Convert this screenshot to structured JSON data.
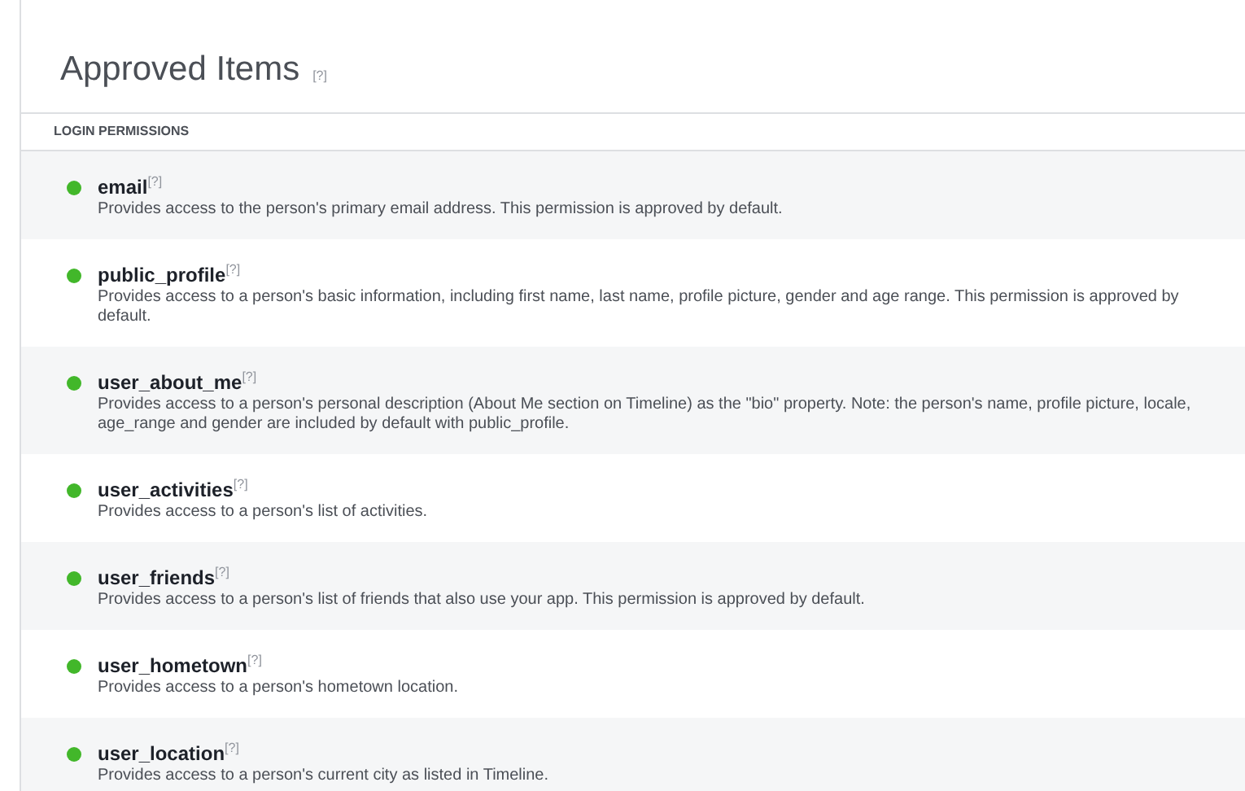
{
  "title": "Approved Items",
  "title_help": "[?]",
  "section": "LOGIN PERMISSIONS",
  "permissions": [
    {
      "name": "email",
      "help": "[?]",
      "color": "#42b72a",
      "description": "Provides access to the person's primary email address. This permission is approved by default."
    },
    {
      "name": "public_profile",
      "help": "[?]",
      "color": "#42b72a",
      "description": "Provides access to a person's basic information, including first name, last name, profile picture, gender and age range. This permission is approved by default."
    },
    {
      "name": "user_about_me",
      "help": "[?]",
      "color": "#42b72a",
      "description": "Provides access to a person's personal description (About Me section on Timeline) as the \"bio\" property. Note: the person's name, profile picture, locale, age_range and gender are included by default with public_profile."
    },
    {
      "name": "user_activities",
      "help": "[?]",
      "color": "#42b72a",
      "description": "Provides access to a person's list of activities."
    },
    {
      "name": "user_friends",
      "help": "[?]",
      "color": "#42b72a",
      "description": "Provides access to a person's list of friends that also use your app. This permission is approved by default."
    },
    {
      "name": "user_hometown",
      "help": "[?]",
      "color": "#42b72a",
      "description": "Provides access to a person's hometown location."
    },
    {
      "name": "user_location",
      "help": "[?]",
      "color": "#42b72a",
      "description": "Provides access to a person's current city as listed in Timeline."
    }
  ]
}
